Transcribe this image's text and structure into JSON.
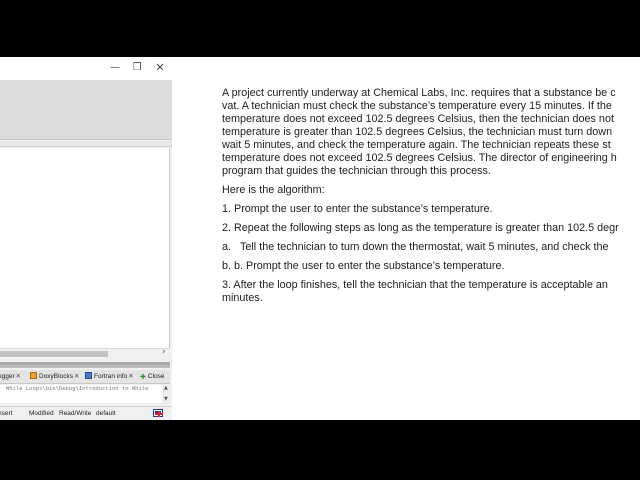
{
  "ide": {
    "window_controls": {
      "minimize": "—",
      "maximize": "❐",
      "close": "✕"
    },
    "log_tabs": [
      {
        "label": "ugger",
        "close": "✕"
      },
      {
        "label": "DoxyBlocks",
        "close": "✕"
      },
      {
        "label": "Fortran info",
        "close": "✕"
      },
      {
        "label": "Close",
        "icon": "close-green-icon"
      }
    ],
    "log_line": "While Loops\\bin\\Debug\\Introduction to While",
    "status": {
      "insert": "nsert",
      "modified": "Modified",
      "read_write": "Read/Write",
      "encoding": "default"
    }
  },
  "document": {
    "intro_lines": [
      "A project currently underway at Chemical Labs, Inc. requires that a substance be c",
      "vat. A technician must check the substance’s temperature every 15 minutes. If the",
      "temperature does not exceed 102.5 degrees Celsius, then the technician does not",
      "temperature is greater than 102.5 degrees Celsius, the technician must turn down",
      "wait 5 minutes, and check the temperature again. The technician repeats these st",
      "temperature does not exceed 102.5 degrees Celsius. The director of engineering h",
      "program that guides the technician through this process."
    ],
    "algorithm_heading": "Here is the algorithm:",
    "step1": "1. Prompt the user to enter the substance’s temperature.",
    "step2": "2. Repeat the following steps as long as the temperature is greater than 102.5 degr",
    "step2a_letter": "a.",
    "step2a_text": "Tell the technician to turn down the thermostat, wait 5 minutes, and check the",
    "step2b": "b.   b. Prompt the user to enter the substance’s temperature.",
    "step3_lines": [
      "3. After the loop finishes, tell the technician that the temperature is acceptable an",
      "minutes."
    ]
  }
}
